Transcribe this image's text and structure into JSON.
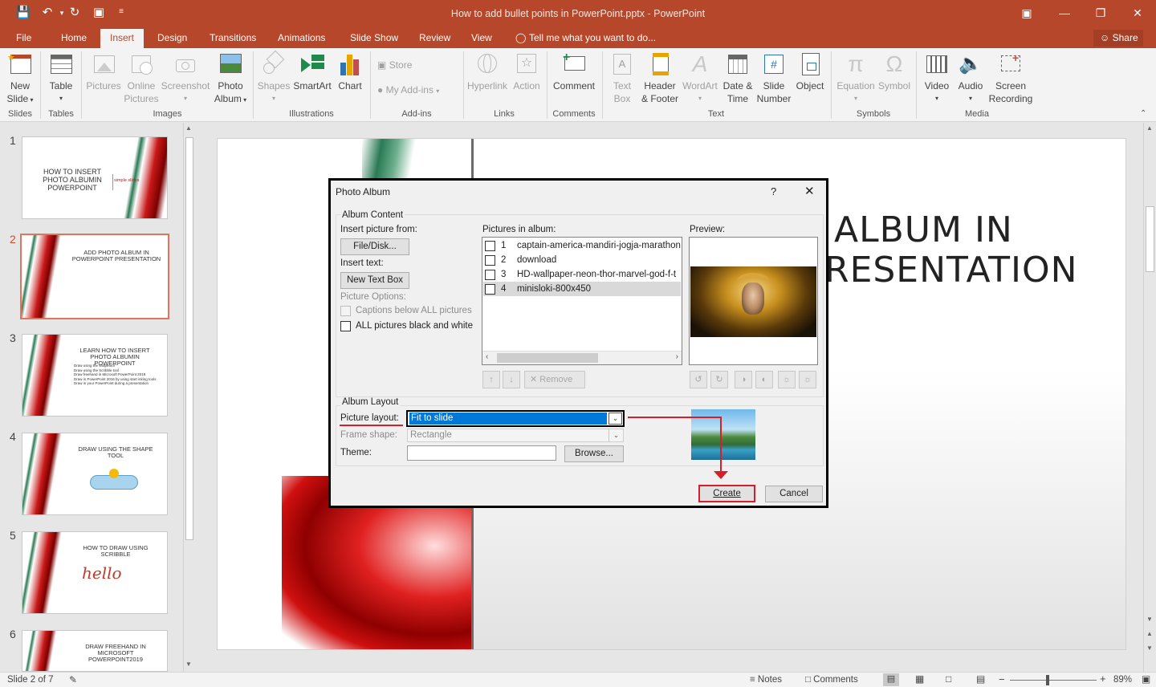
{
  "app": {
    "window_title": "How to add bullet points in PowerPoint.pptx - PowerPoint",
    "accent": "#b7472a",
    "quick_access": {
      "save": "save-icon",
      "undo": "undo-icon",
      "redo": "redo-icon",
      "present": "present-from-start-icon",
      "customize": "customize-qat-icon"
    },
    "window_controls": {
      "ribbon_display": "ribbon-display-options-icon",
      "minimize": "minimize-icon",
      "restore": "restore-icon",
      "close": "close-icon"
    }
  },
  "tabs": [
    "File",
    "Home",
    "Insert",
    "Design",
    "Transitions",
    "Animations",
    "Slide Show",
    "Review",
    "View"
  ],
  "active_tab": "Insert",
  "tell_me": "Tell me what you want to do...",
  "share": "Share",
  "ribbon": {
    "new_slide": [
      "New",
      "Slide"
    ],
    "table": "Table",
    "pictures": "Pictures",
    "online_pictures": [
      "Online",
      "Pictures"
    ],
    "screenshot": "Screenshot",
    "photo_album": [
      "Photo",
      "Album"
    ],
    "shapes": "Shapes",
    "smartart": "SmartArt",
    "chart": "Chart",
    "store": "Store",
    "my_addins": "My Add-ins",
    "hyperlink": "Hyperlink",
    "action": "Action",
    "comment": "Comment",
    "text_box": [
      "Text",
      "Box"
    ],
    "header_footer": [
      "Header",
      "& Footer"
    ],
    "wordart": "WordArt",
    "date_time": [
      "Date &",
      "Time"
    ],
    "slide_number": [
      "Slide",
      "Number"
    ],
    "object": "Object",
    "equation": "Equation",
    "symbol": "Symbol",
    "video": "Video",
    "audio": "Audio",
    "screen_recording": [
      "Screen",
      "Recording"
    ],
    "groups": [
      "Slides",
      "Tables",
      "Images",
      "Illustrations",
      "Add-ins",
      "Links",
      "Comments",
      "Text",
      "Symbols",
      "Media"
    ]
  },
  "thumbnails": [
    {
      "num": "1",
      "text": "HOW TO INSERT PHOTO ALBUMIN POWERPOINT",
      "logo": "simple slides"
    },
    {
      "num": "2",
      "text": "ADD PHOTO ALBUM IN POWERPOINT PRESENTATION"
    },
    {
      "num": "3",
      "text": "LEARN HOW TO INSERT PHOTO ALBUMIN POWERPOINT",
      "bullets": [
        "Draw using the shapetool",
        "Draw using the Scribble tool",
        "Draw freehand in Microsoft PowerPoint 2019",
        "Draw in PowerPoint 2016 by using start inking tools",
        "Draw in your PowerPoint during a presentation"
      ]
    },
    {
      "num": "4",
      "text": "DRAW USING THE SHAPE TOOL"
    },
    {
      "num": "5",
      "text": "HOW TO DRAW USING SCRIBBLE",
      "script": "hello"
    },
    {
      "num": "6",
      "text": "DRAW FREEHAND IN MICROSOFT POWERPOINT2019"
    }
  ],
  "slide": {
    "title_line1": "ALBUM IN",
    "title_line2": "RESENTATION"
  },
  "dialog": {
    "title": "Photo Album",
    "help": "?",
    "close": "close-icon",
    "album_content": "Album Content",
    "insert_picture_from": "Insert picture from:",
    "file_disk": "File/Disk...",
    "insert_text": "Insert text:",
    "new_text_box": "New Text Box",
    "picture_options": "Picture Options:",
    "captions_below": "Captions below ALL pictures",
    "captions_checked": false,
    "black_white": "ALL pictures black and white",
    "black_white_checked": false,
    "pictures_in_album": "Pictures in album:",
    "pictures": [
      {
        "num": "1",
        "name": "captain-america-mandiri-jogja-marathon",
        "checked": false
      },
      {
        "num": "2",
        "name": "download",
        "checked": false
      },
      {
        "num": "3",
        "name": "HD-wallpaper-neon-thor-marvel-god-f-t",
        "checked": false
      },
      {
        "num": "4",
        "name": "minisloki-800x450",
        "checked": false,
        "selected": true
      }
    ],
    "remove": "Remove",
    "preview": "Preview:",
    "album_layout": "Album Layout",
    "picture_layout_label": "Picture layout:",
    "picture_layout_value": "Fit to slide",
    "frame_shape_label": "Frame shape:",
    "frame_shape_value": "Rectangle",
    "theme_label": "Theme:",
    "theme_value": "",
    "browse": "Browse...",
    "create": "Create",
    "cancel": "Cancel",
    "highlight_color": "#d71f2c"
  },
  "status": {
    "slide_info": "Slide 2 of 7",
    "notes": "Notes",
    "comments": "Comments",
    "zoom": "89%",
    "zoom_level": 0.89
  }
}
